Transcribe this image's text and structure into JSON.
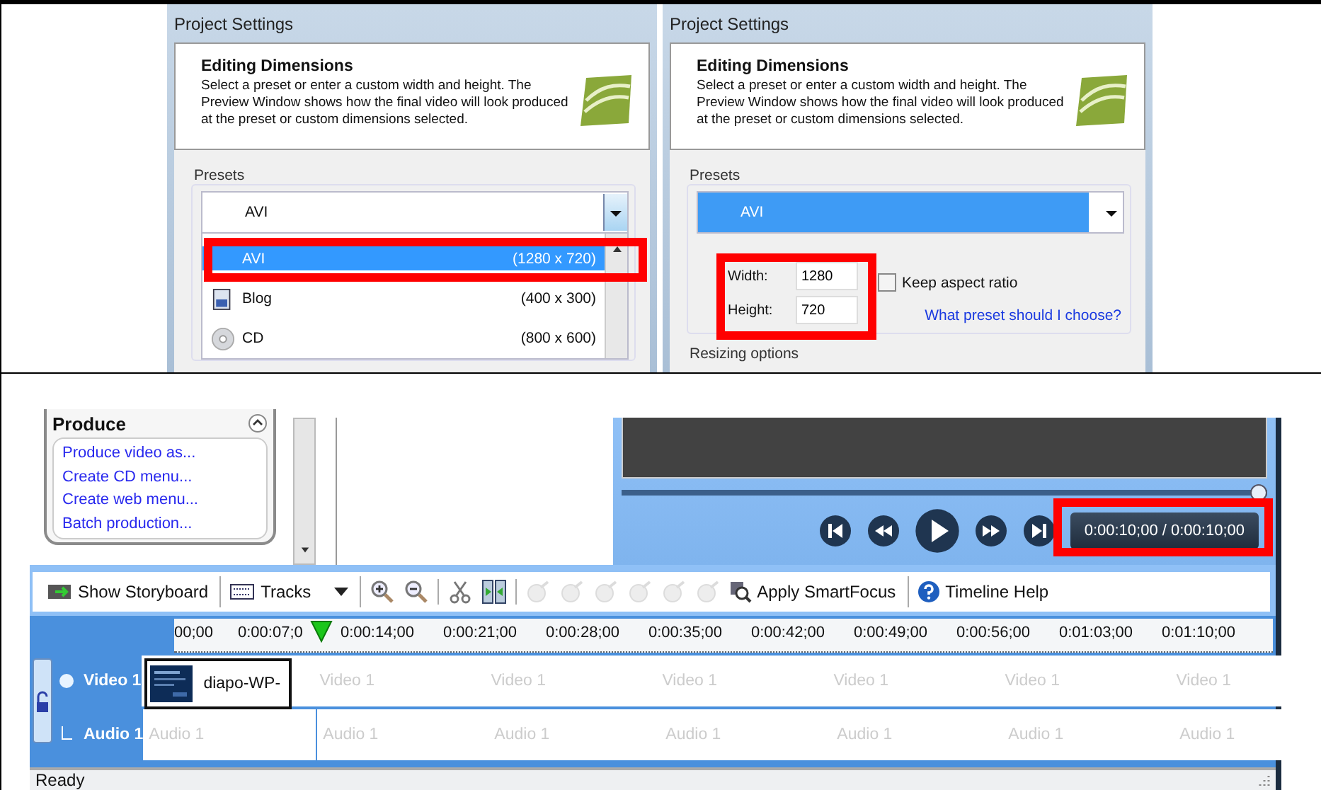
{
  "dialogs": [
    {
      "kind": "list",
      "title": "Project Settings",
      "heading": "Editing Dimensions",
      "description": "Select a preset or enter a custom width and height. The Preview Window shows how the final video will look produced at the preset or custom dimensions selected.",
      "presets_label": "Presets",
      "combo": {
        "value": "AVI",
        "selected": false
      },
      "items": [
        {
          "name": "AVI",
          "size": "(1280 x 720)",
          "selected": true
        },
        {
          "name": "Blog",
          "size": "(400 x 300)",
          "selected": false
        },
        {
          "name": "CD",
          "size": "(800 x 600)",
          "selected": false
        }
      ]
    },
    {
      "kind": "fields",
      "title": "Project Settings",
      "heading": "Editing Dimensions",
      "description": "Select a preset or enter a custom width and height. The Preview Window shows how the final video will look produced at the preset or custom dimensions selected.",
      "presets_label": "Presets",
      "combo": {
        "value": "AVI",
        "selected": true
      },
      "width": {
        "label": "Width:",
        "value": "1280"
      },
      "height": {
        "label": "Height:",
        "value": "720"
      },
      "keep_aspect": {
        "label": "Keep aspect ratio",
        "checked": false
      },
      "link": "What preset should I choose?",
      "section": "Resizing options"
    }
  ],
  "editor": {
    "task_panel": {
      "title": "Produce",
      "links": [
        "Produce video as...",
        "Create CD menu...",
        "Create web menu...",
        "Batch production..."
      ]
    },
    "player": {
      "level": 1,
      "time": "0:00:10;00 / 0:00:10;00"
    },
    "toolbar": [
      {
        "kind": "storyboard",
        "label": "Show Storyboard"
      },
      {
        "kind": "tracks",
        "label": "Tracks"
      },
      {
        "kind": "zoom-in",
        "disabled": false
      },
      {
        "kind": "zoom-out",
        "disabled": false
      },
      {
        "kind": "cut",
        "disabled": false
      },
      {
        "kind": "split",
        "disabled": false
      },
      {
        "kind": "effect",
        "disabled": true
      },
      {
        "kind": "effect",
        "disabled": true
      },
      {
        "kind": "effect",
        "disabled": true
      },
      {
        "kind": "effect",
        "disabled": true
      },
      {
        "kind": "effect",
        "disabled": true
      },
      {
        "kind": "effect",
        "disabled": true
      },
      {
        "kind": "smartfocus",
        "label": "Apply SmartFocus"
      },
      {
        "kind": "help",
        "label": "Timeline Help"
      }
    ],
    "ruler": [
      "00;00",
      "0:00:07;0",
      "0:00:14;00",
      "0:00:21;00",
      "0:00:28;00",
      "0:00:35;00",
      "0:00:42;00",
      "0:00:49;00",
      "0:00:56;00",
      "0:01:03;00",
      "0:01:10;00"
    ],
    "tracks": [
      {
        "kind": "video",
        "name": "Video 1",
        "clip": "diapo-WP-",
        "fillers": [
          "Video 1",
          "Video 1",
          "Video 1",
          "Video 1",
          "Video 1",
          "Video 1"
        ]
      },
      {
        "kind": "audio",
        "name": "Audio 1",
        "fillers": [
          "Audio 1",
          "Audio 1",
          "Audio 1",
          "Audio 1",
          "Audio 1",
          "Audio 1",
          "Audio 1"
        ]
      }
    ],
    "status_bar": "Ready"
  }
}
